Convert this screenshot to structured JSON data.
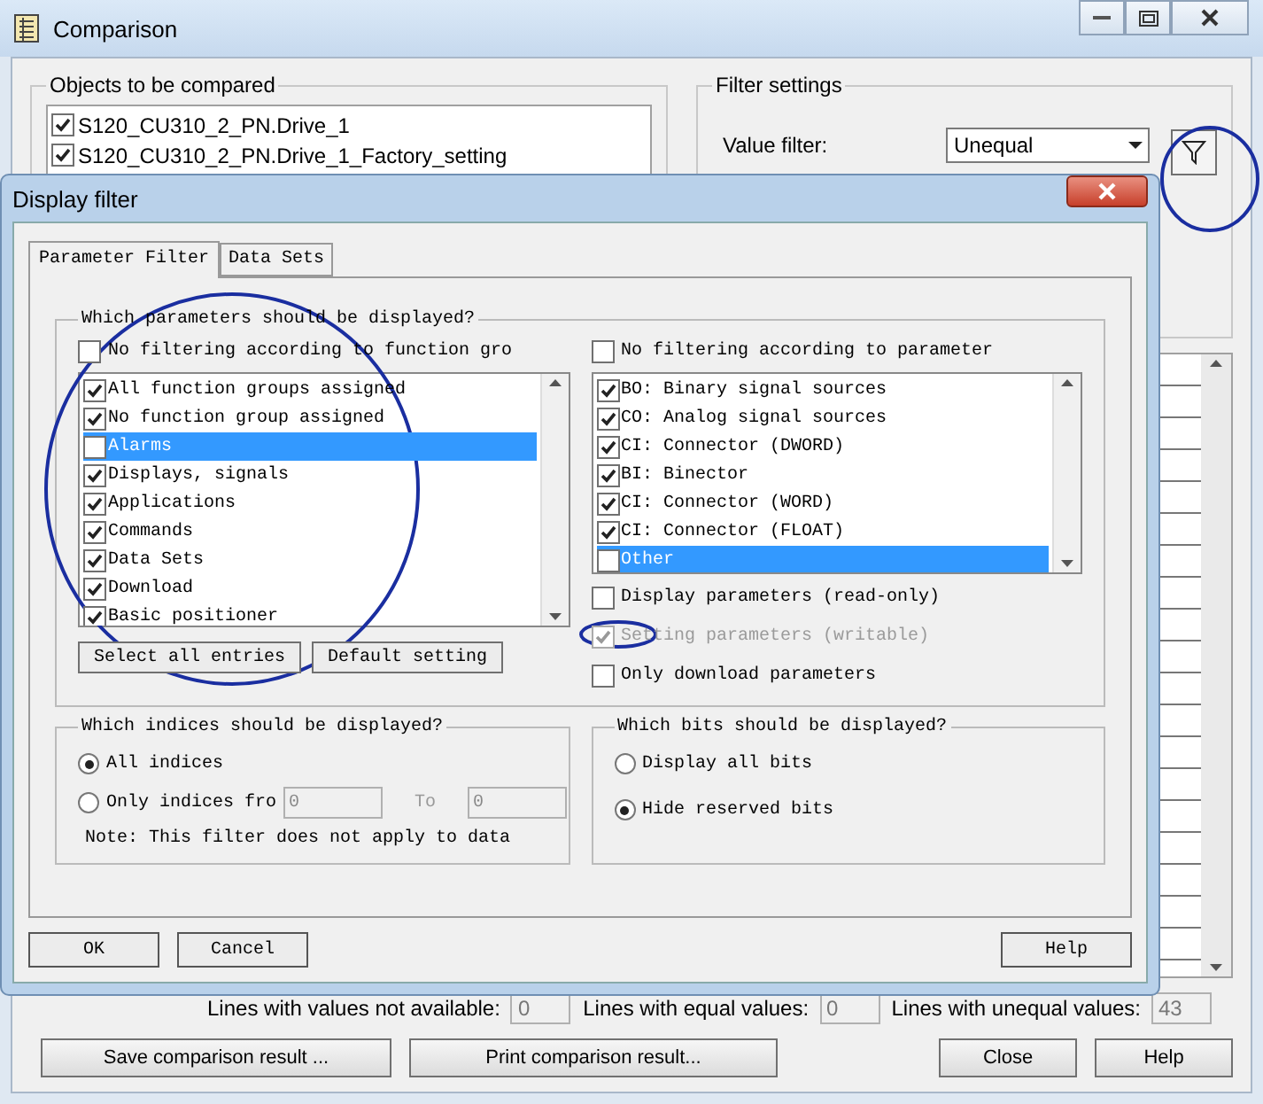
{
  "window": {
    "title": "Comparison",
    "objects_group": {
      "title": "Objects to be compared",
      "items": [
        {
          "label": "S120_CU310_2_PN.Drive_1",
          "checked": true
        },
        {
          "label": "S120_CU310_2_PN.Drive_1_Factory_setting",
          "checked": true
        }
      ]
    },
    "filter_group": {
      "title": "Filter settings",
      "value_filter": {
        "label": "Value filter:",
        "value": "Unequal"
      }
    },
    "counts": [
      {
        "label": "Lines with values not available:",
        "value": "0"
      },
      {
        "label": "Lines with equal values:",
        "value": "0"
      },
      {
        "label": "Lines with unequal values:",
        "value": "43"
      }
    ],
    "buttons": [
      "Save comparison result ...",
      "Print comparison result...",
      "Close",
      "Help"
    ]
  },
  "dialog": {
    "title": "Display filter",
    "tabs": [
      {
        "label": "Parameter Filter",
        "selected": true
      },
      {
        "label": "Data Sets",
        "selected": false
      }
    ],
    "params_group": {
      "title": "Which parameters should be displayed?",
      "function_filter": {
        "label": "No filtering according to function gro",
        "checked": false
      },
      "function_groups": [
        {
          "label": "All function groups assigned",
          "checked": true,
          "selected": false
        },
        {
          "label": "No function group assigned",
          "checked": true,
          "selected": false
        },
        {
          "label": "Alarms",
          "checked": false,
          "selected": true
        },
        {
          "label": "Displays, signals",
          "checked": true,
          "selected": false
        },
        {
          "label": "Applications",
          "checked": true,
          "selected": false
        },
        {
          "label": "Commands",
          "checked": true,
          "selected": false
        },
        {
          "label": "Data Sets",
          "checked": true,
          "selected": false
        },
        {
          "label": "Download",
          "checked": true,
          "selected": false
        },
        {
          "label": "Basic positioner",
          "checked": true,
          "selected": false
        }
      ],
      "parameter_filter": {
        "label": "No filtering according to parameter",
        "checked": false
      },
      "parameter_types": [
        {
          "label": "BO: Binary signal sources",
          "checked": true,
          "selected": false
        },
        {
          "label": "CO: Analog signal sources",
          "checked": true,
          "selected": false
        },
        {
          "label": "CI: Connector (DWORD)",
          "checked": true,
          "selected": false
        },
        {
          "label": "BI: Binector",
          "checked": true,
          "selected": false
        },
        {
          "label": "CI: Connector (WORD)",
          "checked": true,
          "selected": false
        },
        {
          "label": "CI: Connector (FLOAT)",
          "checked": true,
          "selected": false
        },
        {
          "label": "Other",
          "checked": false,
          "selected": true
        }
      ],
      "options": [
        {
          "label": "Display parameters (read-only)",
          "checked": false,
          "disabled": false
        },
        {
          "label": "Setting parameters (writable)",
          "checked": true,
          "disabled": true
        },
        {
          "label": "Only download parameters",
          "checked": false,
          "disabled": false
        }
      ],
      "buttons": [
        "Select all entries",
        "Default setting"
      ]
    },
    "indices_group": {
      "title": "Which indices should be displayed?",
      "options": [
        {
          "label": "All indices",
          "selected": true
        },
        {
          "label": "Only indices fro",
          "selected": false
        }
      ],
      "from": "0",
      "to_label": "To",
      "to": "0",
      "note": "Note: This filter does not apply to data"
    },
    "bits_group": {
      "title": "Which bits should be displayed?",
      "options": [
        {
          "label": "Display all bits",
          "selected": false
        },
        {
          "label": "Hide reserved bits",
          "selected": true
        }
      ]
    },
    "buttons": [
      "OK",
      "Cancel",
      "Help"
    ]
  }
}
